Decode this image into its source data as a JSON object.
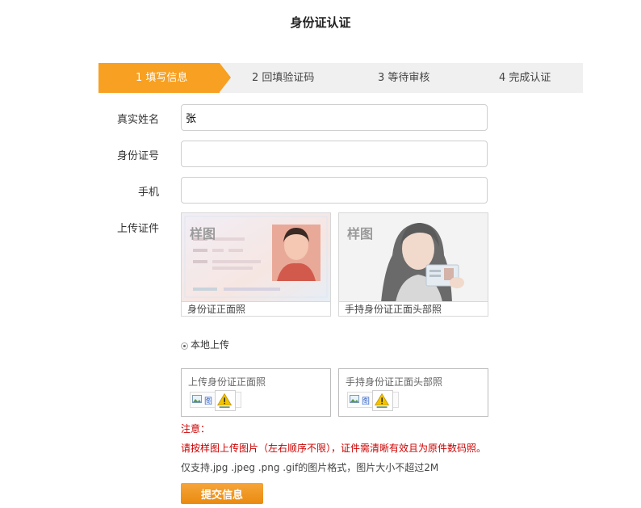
{
  "page": {
    "title": "身份证认证"
  },
  "steps": [
    {
      "label": "1 填写信息",
      "active": true
    },
    {
      "label": "2 回填验证码",
      "active": false
    },
    {
      "label": "3 等待审核",
      "active": false
    },
    {
      "label": "4 完成认证",
      "active": false
    }
  ],
  "form": {
    "name": {
      "label": "真实姓名",
      "value": "张"
    },
    "id_number": {
      "label": "身份证号",
      "value": ""
    },
    "phone": {
      "label": "手机",
      "value": ""
    },
    "upload_label": "上传证件"
  },
  "samples": {
    "watermark": "样图",
    "front_caption": "身份证正面照",
    "handheld_caption": "手持身份证正面头部照"
  },
  "upload": {
    "radio_label": "本地上传",
    "front_label": "上传身份证正面照",
    "handheld_label": "手持身份证正面头部照",
    "file_text": "图"
  },
  "notes": {
    "title": "注意：",
    "instruction": "请按样图上传图片（左右顺序不限），证件需清晰有效且为原件数码照。",
    "format": "仅支持.jpg .jpeg .png .gif的图片格式，图片大小不超过2M"
  },
  "submit_label": "提交信息",
  "colors": {
    "accent": "#f7a021",
    "warning_text": "#cc0000",
    "button": "#ec8f18"
  }
}
